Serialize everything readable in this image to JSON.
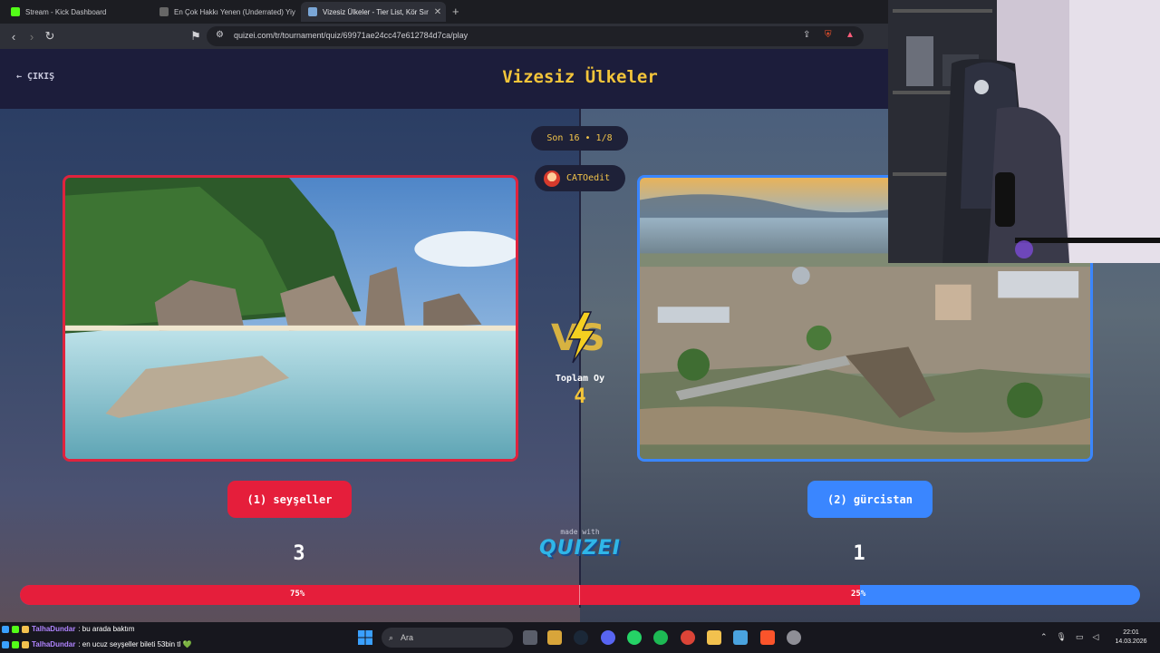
{
  "browser": {
    "tabs": [
      {
        "title": "Stream - Kick Dashboard",
        "favicon_color": "#53fc18"
      },
      {
        "title": "En Çok Hakkı Yenen (Underrated) Yiy",
        "favicon_color": "#666666"
      },
      {
        "title": "Vizesiz Ülkeler - Tier List, Kör Sır",
        "favicon_color": "#7aa6d6"
      }
    ],
    "active_tab": 2,
    "url": "quizei.com/tr/tournament/quiz/69971ae24cc47e612784d7ca/play"
  },
  "quiz": {
    "exit_label": "ÇIKIŞ",
    "title": "Vizesiz Ülkeler",
    "round_label": "Son 16 • 1/8",
    "creator": "CATOedit",
    "total_label": "Toplam Oy",
    "total_votes": "4",
    "left": {
      "label": "(1) seyşeller",
      "votes": "3",
      "percent": "75%",
      "fraction": 0.75,
      "color": "#e51e3b"
    },
    "right": {
      "label": "(2) gürcistan",
      "votes": "1",
      "percent": "25%",
      "fraction": 0.25,
      "color": "#3a86ff"
    },
    "made_with": "made with",
    "brand": "QUIZEI"
  },
  "chat": [
    {
      "user": "TalhaDundar",
      "message": ": bu arada baktım"
    },
    {
      "user": "TalhaDundar",
      "message": ": en ucuz seyşeller bileti 53bin tl 💚"
    }
  ],
  "taskbar": {
    "search_placeholder": "Ara",
    "clock_time": "22:01",
    "clock_date": "14.03.2026"
  }
}
